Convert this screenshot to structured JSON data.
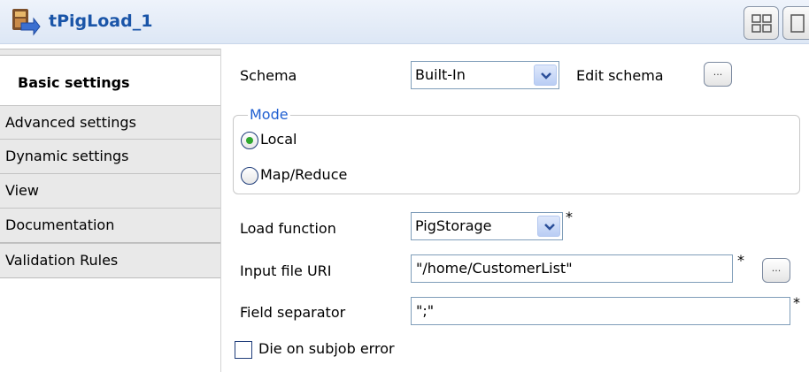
{
  "header": {
    "title": "tPigLoad_1"
  },
  "tabs": [
    {
      "label": "Basic settings",
      "active": true
    },
    {
      "label": "Advanced settings",
      "active": false
    },
    {
      "label": "Dynamic settings",
      "active": false
    },
    {
      "label": "View",
      "active": false
    },
    {
      "label": "Documentation",
      "active": false
    },
    {
      "label": "Validation Rules",
      "active": false
    }
  ],
  "form": {
    "schema_label": "Schema",
    "schema_value": "Built-In",
    "edit_schema_label": "Edit schema",
    "mode_title": "Mode",
    "mode_local_label": "Local",
    "mode_mapreduce_label": "Map/Reduce",
    "mode_selected": "Local",
    "load_function_label": "Load function",
    "load_function_value": "PigStorage",
    "input_file_label": "Input file URI",
    "input_file_value": "\"/home/CustomerList\"",
    "field_separator_label": "Field separator",
    "field_separator_value": "\";\"",
    "die_on_error_label": "Die on subjob error",
    "die_on_error_checked": false,
    "required_marker": "*",
    "dots_label": "..."
  }
}
